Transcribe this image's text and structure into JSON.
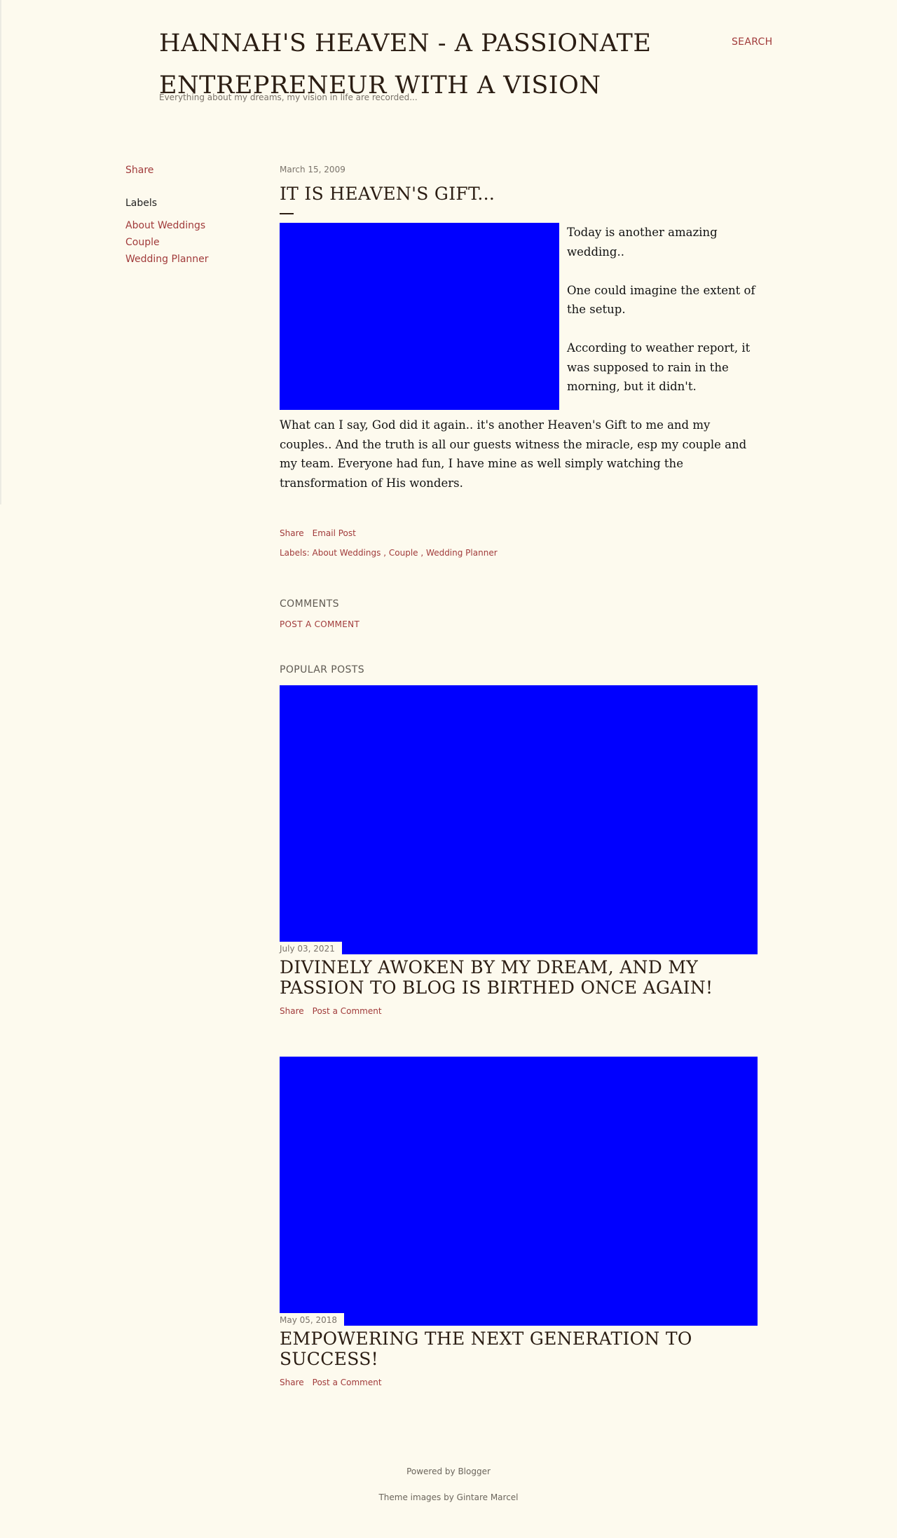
{
  "header": {
    "title": "HANNAH'S HEAVEN - A PASSIONATE ENTREPRENEUR WITH A VISION",
    "description": "Everything about my dreams, my vision in life are recorded...",
    "search_label": "SEARCH"
  },
  "sidebar": {
    "share_label": "Share",
    "labels_heading": "Labels",
    "labels": [
      "About Weddings",
      "Couple",
      "Wedding Planner"
    ]
  },
  "post": {
    "date": "March 15, 2009",
    "title": "IT IS HEAVEN'S GIFT...",
    "paragraphs": [
      "Today is another amazing wedding..",
      "One could imagine the extent of the setup.",
      "According to weather report, it was supposed to rain in the morning, but it didn't.",
      "What can I say, God did it again.. it's another Heaven's Gift to me and my couples.. And the truth is all our guests witness the miracle, esp my couple and my team. Everyone had fun, I have mine as well simply watching the transformation of His wonders."
    ],
    "share_label": "Share",
    "email_label": "Email Post",
    "labels_prefix": "Labels:",
    "labels": [
      "About Weddings",
      "Couple",
      "Wedding Planner"
    ]
  },
  "comments": {
    "heading": "COMMENTS",
    "post_comment_label": "POST A COMMENT"
  },
  "popular": {
    "heading": "POPULAR POSTS",
    "items": [
      {
        "date": "July 03, 2021",
        "title": "DIVINELY AWOKEN BY MY DREAM, AND MY PASSION TO BLOG IS BIRTHED ONCE AGAIN!",
        "share_label": "Share",
        "comment_label": "Post a Comment"
      },
      {
        "date": "May 05, 2018",
        "title": "EMPOWERING THE NEXT GENERATION TO SUCCESS!",
        "share_label": "Share",
        "comment_label": "Post a Comment"
      }
    ]
  },
  "footer": {
    "powered": "Powered by Blogger",
    "theme": "Theme images by Gintare Marcel"
  },
  "colors": {
    "background": "#fdfaee",
    "link": "#a13b3b",
    "title": "#2b1d13",
    "image_placeholder": "#0000ff"
  }
}
